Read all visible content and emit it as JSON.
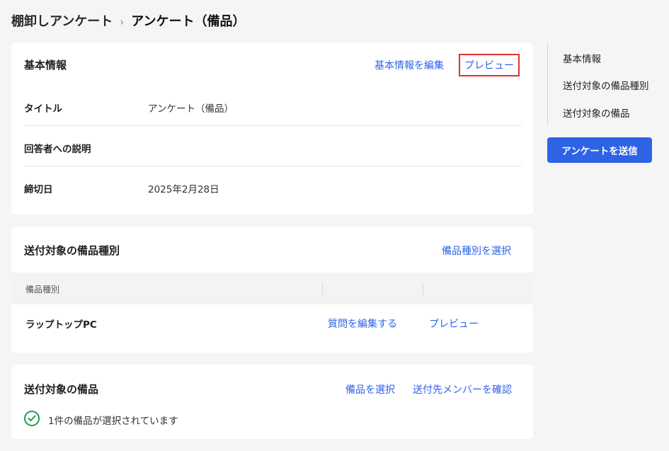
{
  "breadcrumb": {
    "parent": "棚卸しアンケート",
    "separator": "›",
    "current": "アンケート（備品）"
  },
  "basic_info": {
    "title": "基本情報",
    "edit_link": "基本情報を編集",
    "preview_link": "プレビュー",
    "rows": [
      {
        "label": "タイトル",
        "value": "アンケート（備品）"
      },
      {
        "label": "回答者への説明",
        "value": ""
      },
      {
        "label": "締切日",
        "value": "2025年2月28日"
      }
    ]
  },
  "target_types": {
    "title": "送付対象の備品種別",
    "select_link": "備品種別を選択",
    "column_header": "備品種別",
    "rows": [
      {
        "name": "ラップトップPC",
        "edit_link": "質問を編集する",
        "preview_link": "プレビュー"
      }
    ]
  },
  "target_items": {
    "title": "送付対象の備品",
    "select_link": "備品を選択",
    "members_link": "送付先メンバーを確認",
    "status_text": "1件の備品が選択されています"
  },
  "side_nav": {
    "items": [
      "基本情報",
      "送付対象の備品種別",
      "送付対象の備品"
    ]
  },
  "send_button": "アンケートを送信",
  "colors": {
    "accent": "#2e63e6",
    "highlight_border": "#e03131",
    "success": "#1f9d55"
  },
  "icons": {
    "status": "check-circle-icon",
    "breadcrumb_separator": "chevron-right-icon"
  }
}
